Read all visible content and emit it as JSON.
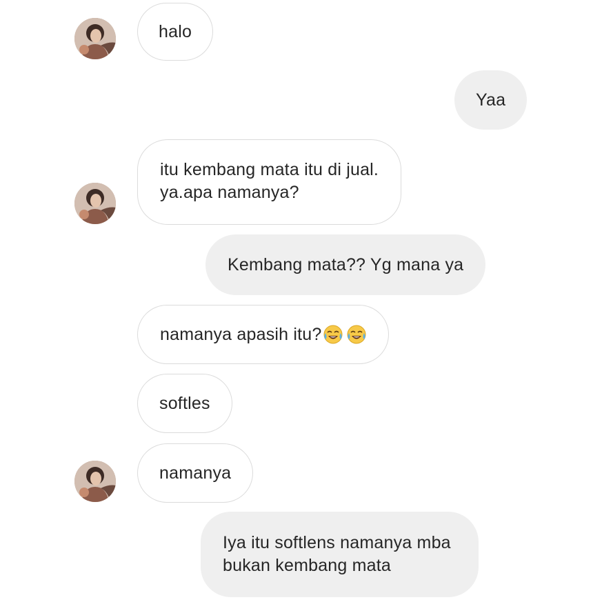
{
  "conversation": {
    "messages": [
      {
        "sender": "them",
        "avatar": true,
        "lines": [
          "halo"
        ]
      },
      {
        "sender": "me",
        "lines": [
          "Yaa"
        ]
      },
      {
        "sender": "them",
        "avatar": true,
        "lines": [
          "itu kembang mata itu di jual.",
          "ya.apa namanya?"
        ]
      },
      {
        "sender": "me",
        "lines": [
          "Kembang mata?? Yg mana ya"
        ]
      },
      {
        "sender": "them",
        "avatar": false,
        "lines": [
          "namanya apasih itu?"
        ],
        "emojis": [
          "face-with-tears-of-joy",
          "face-with-tears-of-joy"
        ]
      },
      {
        "sender": "them",
        "avatar": false,
        "lines": [
          "softles"
        ]
      },
      {
        "sender": "them",
        "avatar": true,
        "lines": [
          "namanya"
        ]
      },
      {
        "sender": "me",
        "lines": [
          "Iya itu softlens namanya mba",
          "bukan kembang mata"
        ]
      }
    ]
  },
  "colors": {
    "incoming_bubble": "#ffffff",
    "incoming_border": "#dbdbdb",
    "outgoing_bubble": "#efefef",
    "text": "#262626"
  },
  "icons": {
    "avatar": "profile-photo",
    "emoji": "face-with-tears-of-joy"
  }
}
